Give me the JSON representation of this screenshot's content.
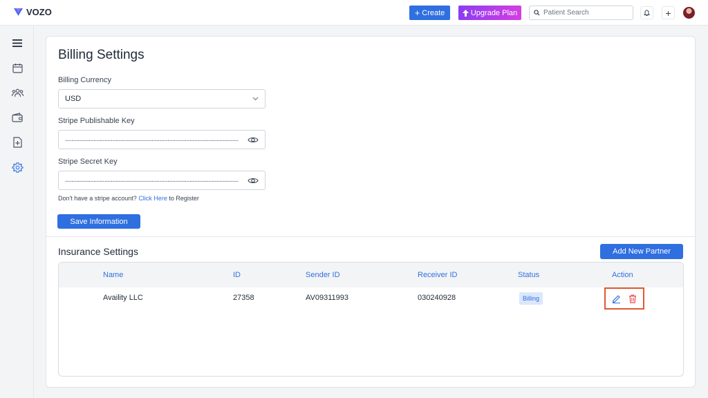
{
  "topbar": {
    "brand": "VOZO",
    "create_label": "Create",
    "upgrade_label": "Upgrade Plan",
    "search_placeholder": "Patient Search"
  },
  "sidebar": {
    "items": [
      {
        "name": "menu-icon"
      },
      {
        "name": "calendar-icon"
      },
      {
        "name": "patients-icon"
      },
      {
        "name": "wallet-icon"
      },
      {
        "name": "document-add-icon"
      },
      {
        "name": "gear-icon",
        "active": true
      }
    ]
  },
  "billing": {
    "title": "Billing Settings",
    "currency_label": "Billing Currency",
    "currency_value": "USD",
    "publishable_label": "Stripe Publishable Key",
    "secret_label": "Stripe Secret Key",
    "masked_value": "..............................................................................................................",
    "hint_prefix": "Don't have a stripe account?",
    "hint_link": "Click Here",
    "hint_suffix": "to Register",
    "save_label": "Save Information"
  },
  "insurance": {
    "title": "Insurance Settings",
    "add_label": "Add New Partner",
    "columns": [
      "Name",
      "ID",
      "Sender ID",
      "Receiver ID",
      "Status",
      "Action"
    ],
    "rows": [
      {
        "name": "Availity LLC",
        "id": "27358",
        "sender_id": "AV09311993",
        "receiver_id": "030240928",
        "status": "Billing"
      }
    ]
  },
  "colors": {
    "accent": "#2f6fe0",
    "highlight": "#e2572f",
    "delete": "#e5484d"
  }
}
